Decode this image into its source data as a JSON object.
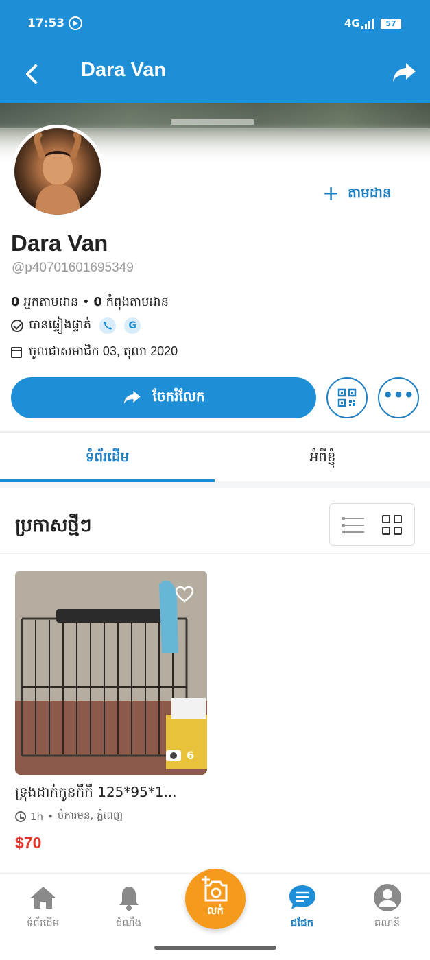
{
  "status_bar": {
    "time": "17:53",
    "network": "4G",
    "battery": "57"
  },
  "app_bar": {
    "title": "Dara Van"
  },
  "profile": {
    "name": "Dara Van",
    "handle": "@p40701601695349",
    "followers_count": "0",
    "followers_label": "អ្នកតាមដាន",
    "following_count": "0",
    "following_label": "កំពុងតាមដាន",
    "verified_label": "បានផ្ទៀងផ្ទាត់",
    "verified_badges": [
      "phone-icon",
      "google-icon"
    ],
    "google_badge": "G",
    "joined": "ចូលជាសមាជិក 03, តុលា 2020",
    "follow_label": "តាមដាន",
    "share_label": "ចែករំលែក"
  },
  "tabs": [
    {
      "label": "ទំព័រដើម",
      "active": true
    },
    {
      "label": "អំពីខ្ញុំ",
      "active": false
    }
  ],
  "listings_section": {
    "title": "ប្រកាសថ្មីៗ",
    "view_mode": "grid"
  },
  "listings": [
    {
      "title": "ទ្រុងដាក់កូនកីកី 125*95*1...",
      "time": "1h",
      "location": "ចំការមន, ភ្នំពេញ",
      "price": "$70",
      "photo_count": "6"
    }
  ],
  "bottom_nav": [
    {
      "label": "ទំព័រដើម",
      "icon": "home-icon"
    },
    {
      "label": "ដំណឹង",
      "icon": "bell-icon"
    },
    {
      "label": "លក់",
      "icon": "camera-plus-icon"
    },
    {
      "label": "ជជែក",
      "icon": "chat-icon",
      "active": true
    },
    {
      "label": "គណនី",
      "icon": "account-icon"
    }
  ],
  "colors": {
    "primary": "#1e8fd6",
    "accent_text": "#1f7fc0",
    "sell": "#f59a1b",
    "price": "#e1372b"
  }
}
